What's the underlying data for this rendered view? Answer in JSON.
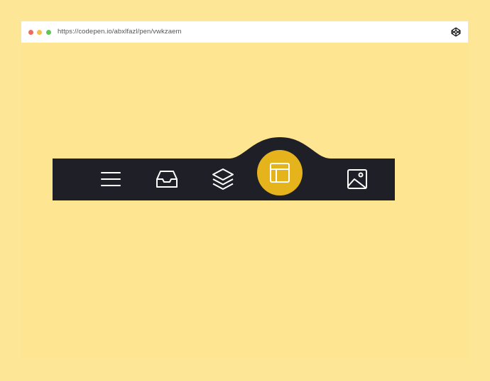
{
  "browser": {
    "url": "https://codepen.io/abxlfazl/pen/vwkzaem",
    "dots": [
      "#ed6b5f",
      "#f5bf4f",
      "#61c554"
    ],
    "icon": "codepen-icon"
  },
  "colors": {
    "background": "#fde797",
    "bar": "#1e1f27",
    "accent": "#e5b31b",
    "icon_stroke": "#ffffff"
  },
  "tabbar": {
    "items": [
      {
        "icon": "menu-icon",
        "active": false
      },
      {
        "icon": "inbox-icon",
        "active": false
      },
      {
        "icon": "layers-icon",
        "active": false
      },
      {
        "icon": "layout-icon",
        "active": true
      },
      {
        "icon": "image-icon",
        "active": false
      }
    ]
  }
}
